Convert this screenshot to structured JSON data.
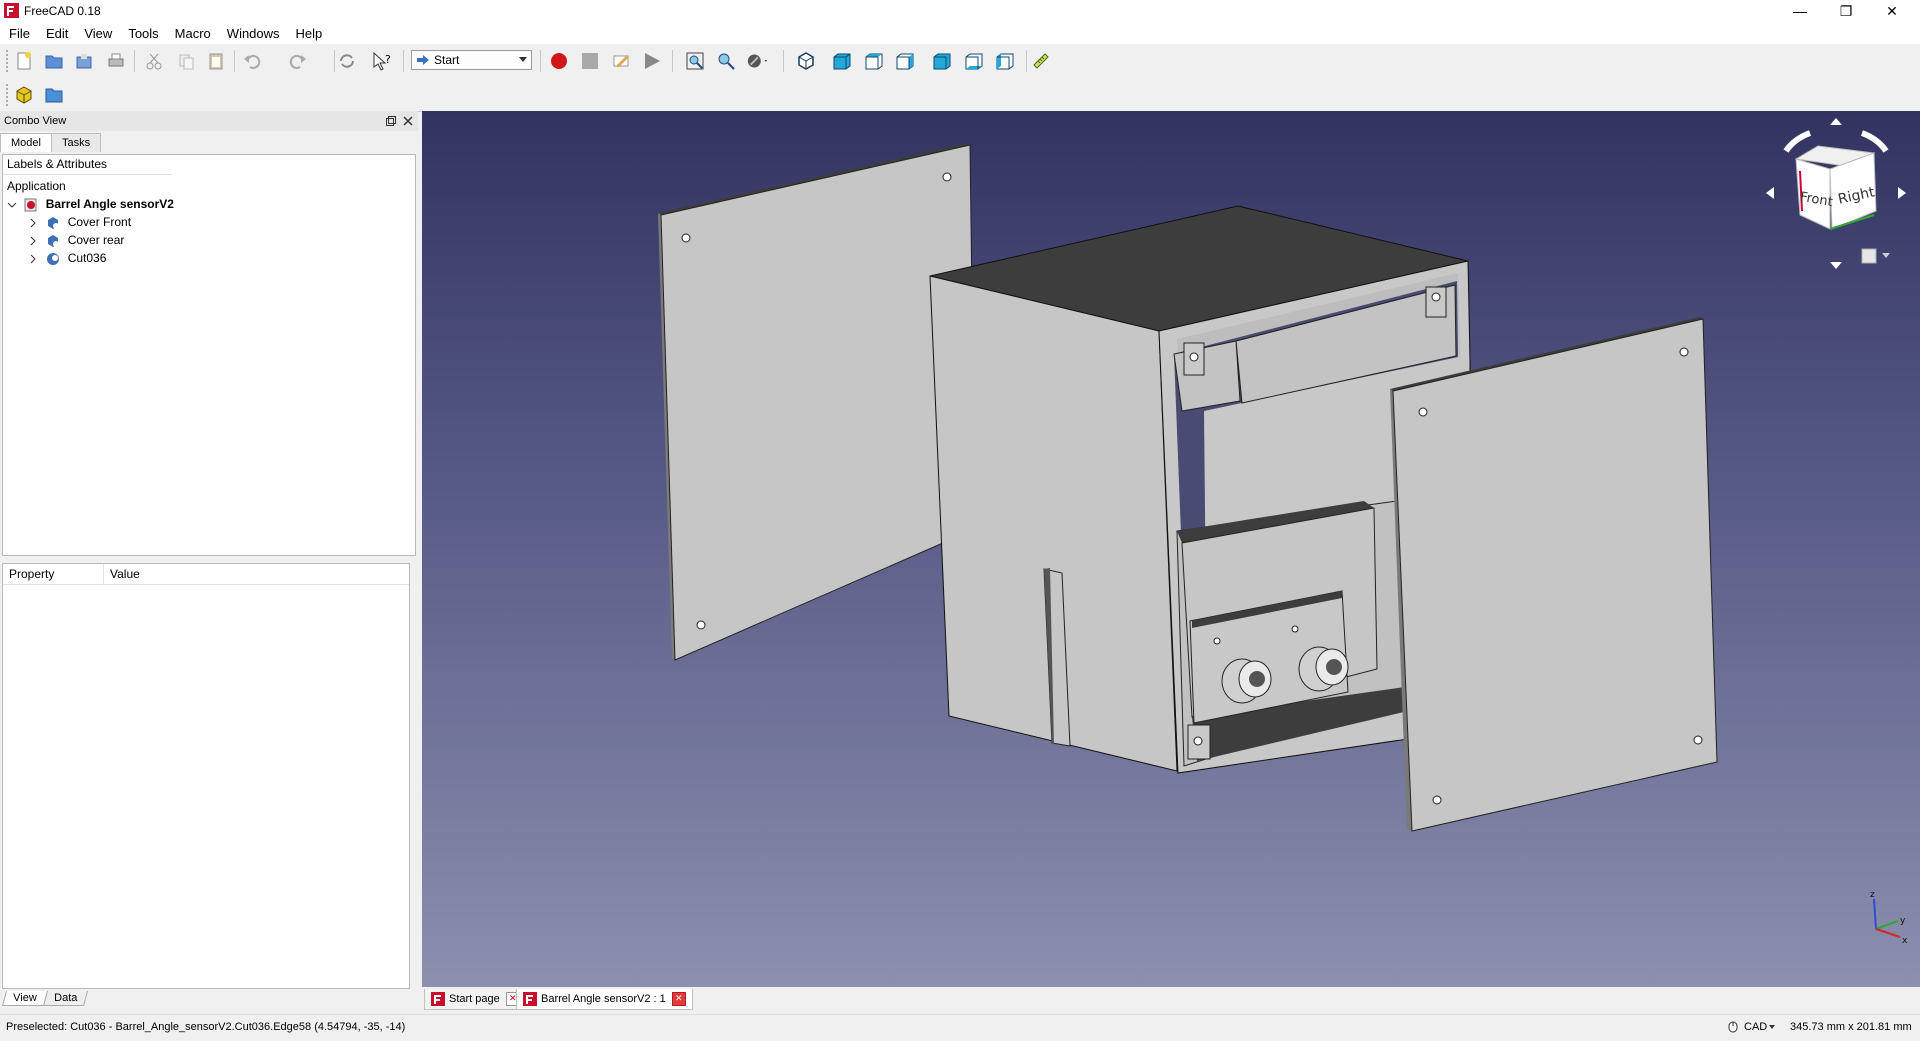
{
  "window": {
    "title": "FreeCAD 0.18",
    "controls": {
      "minimize": "—",
      "maximize": "❐",
      "close": "✕"
    }
  },
  "menu": [
    "File",
    "Edit",
    "View",
    "Tools",
    "Macro",
    "Windows",
    "Help"
  ],
  "toolbar": {
    "workbench": "Start",
    "icons": [
      "new-file-icon",
      "open-file-icon",
      "save-icon",
      "print-icon",
      "cut-icon",
      "copy-icon",
      "paste-icon",
      "undo-icon",
      "redo-icon",
      "refresh-icon",
      "whats-this-icon",
      "record-macro-icon",
      "stop-macro-icon",
      "edit-macro-icon",
      "run-macro-icon",
      "fit-all-icon",
      "fit-selection-icon",
      "draw-style-icon",
      "isometric-view-icon",
      "front-view-icon",
      "top-view-icon",
      "right-view-icon",
      "rear-view-icon",
      "bottom-view-icon",
      "left-view-icon",
      "measure-icon"
    ]
  },
  "toolbar2": {
    "icons": [
      "part-icon",
      "folder-icon"
    ]
  },
  "combo_view": {
    "title": "Combo View",
    "tabs": [
      "Model",
      "Tasks"
    ],
    "tree": {
      "header": "Labels & Attributes",
      "root": "Application",
      "document": "Barrel Angle sensorV2",
      "items": [
        "Cover Front",
        "Cover rear",
        "Cut036"
      ]
    },
    "property": {
      "col1": "Property",
      "col2": "Value"
    },
    "bottom_tabs": [
      "View",
      "Data"
    ]
  },
  "navcube": {
    "front": "Front",
    "right": "Right"
  },
  "axis": {
    "z": "z",
    "y": "y",
    "x": "x"
  },
  "doc_tabs": [
    "Start page",
    "Barrel Angle sensorV2 : 1"
  ],
  "status": {
    "message": "Preselected: Cut036 - Barrel_Angle_sensorV2.Cut036.Edge58 (4.54794, -35, -14)",
    "nav_style": "CAD",
    "dimensions": "345.73 mm x 201.81 mm"
  },
  "colors": {
    "bg_top": "#323360",
    "bg_bottom": "#8c8fae",
    "part_face": "#c6c6c6",
    "part_dark": "#3d3d3d",
    "record_red": "#d01818"
  }
}
